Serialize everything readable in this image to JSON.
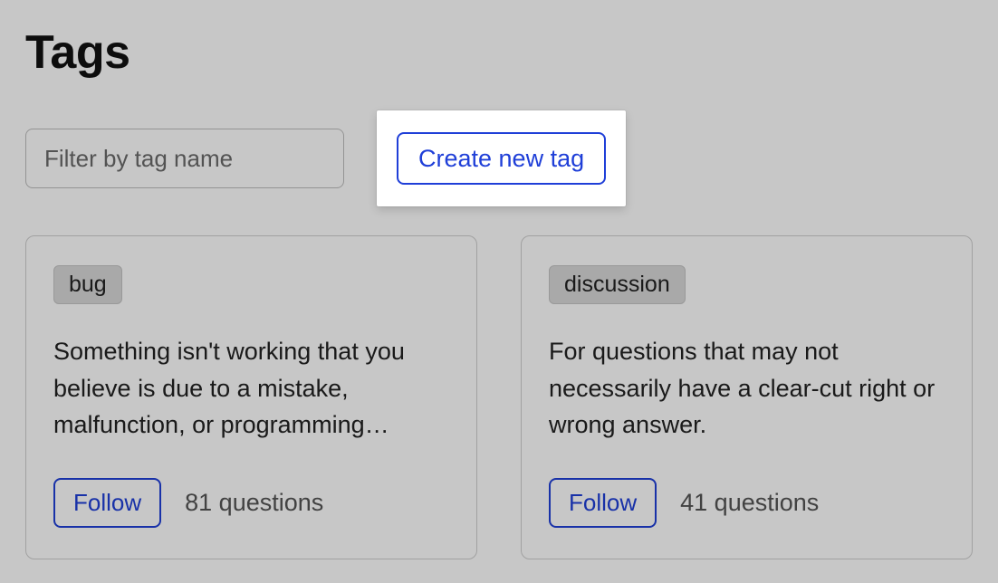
{
  "header": {
    "title": "Tags"
  },
  "filter": {
    "placeholder": "Filter by tag name"
  },
  "create_button": {
    "label": "Create new tag"
  },
  "tags": [
    {
      "name": "bug",
      "description": "Something isn't working that you believe is due to a mistake, malfunction, or programming…",
      "follow_label": "Follow",
      "question_count_text": "81 questions"
    },
    {
      "name": "discussion",
      "description": "For questions that may not necessarily have a clear-cut right or wrong answer.",
      "follow_label": "Follow",
      "question_count_text": "41 questions"
    }
  ],
  "colors": {
    "accent": "#1f3fd8",
    "chip_bg": "#d9d9d9"
  }
}
